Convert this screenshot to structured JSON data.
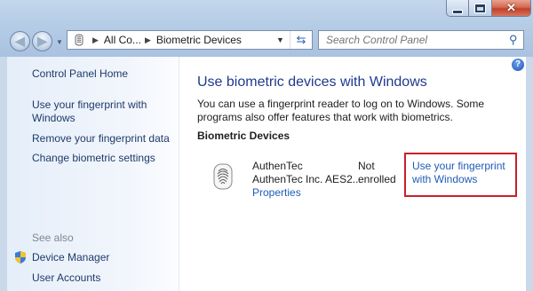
{
  "window": {
    "minimize_icon": "minimize-icon",
    "maximize_icon": "maximize-icon",
    "close_icon": "close-icon"
  },
  "address": {
    "crumbs": [
      "All Co...",
      "Biometric Devices"
    ],
    "icon": "control-panel-icon"
  },
  "search": {
    "placeholder": "Search Control Panel"
  },
  "sidebar": {
    "home": "Control Panel Home",
    "links": [
      "Use your fingerprint with Windows",
      "Remove your fingerprint data",
      "Change biometric settings"
    ],
    "see_also_heading": "See also",
    "see_also": [
      "Device Manager",
      "User Accounts"
    ]
  },
  "main": {
    "title": "Use biometric devices with Windows",
    "description": "You can use a fingerprint reader to log on to Windows. Some programs also offer features that work with biometrics.",
    "section_heading": "Biometric Devices",
    "device": {
      "name": "AuthenTec",
      "subtitle": "AuthenTec Inc. AES2...",
      "properties_link": "Properties",
      "status": "Not enrolled",
      "action_link": "Use your fingerprint with Windows"
    }
  },
  "colors": {
    "link": "#1e5bb8",
    "title": "#1e3a8c",
    "highlight_border": "#c8202a"
  }
}
